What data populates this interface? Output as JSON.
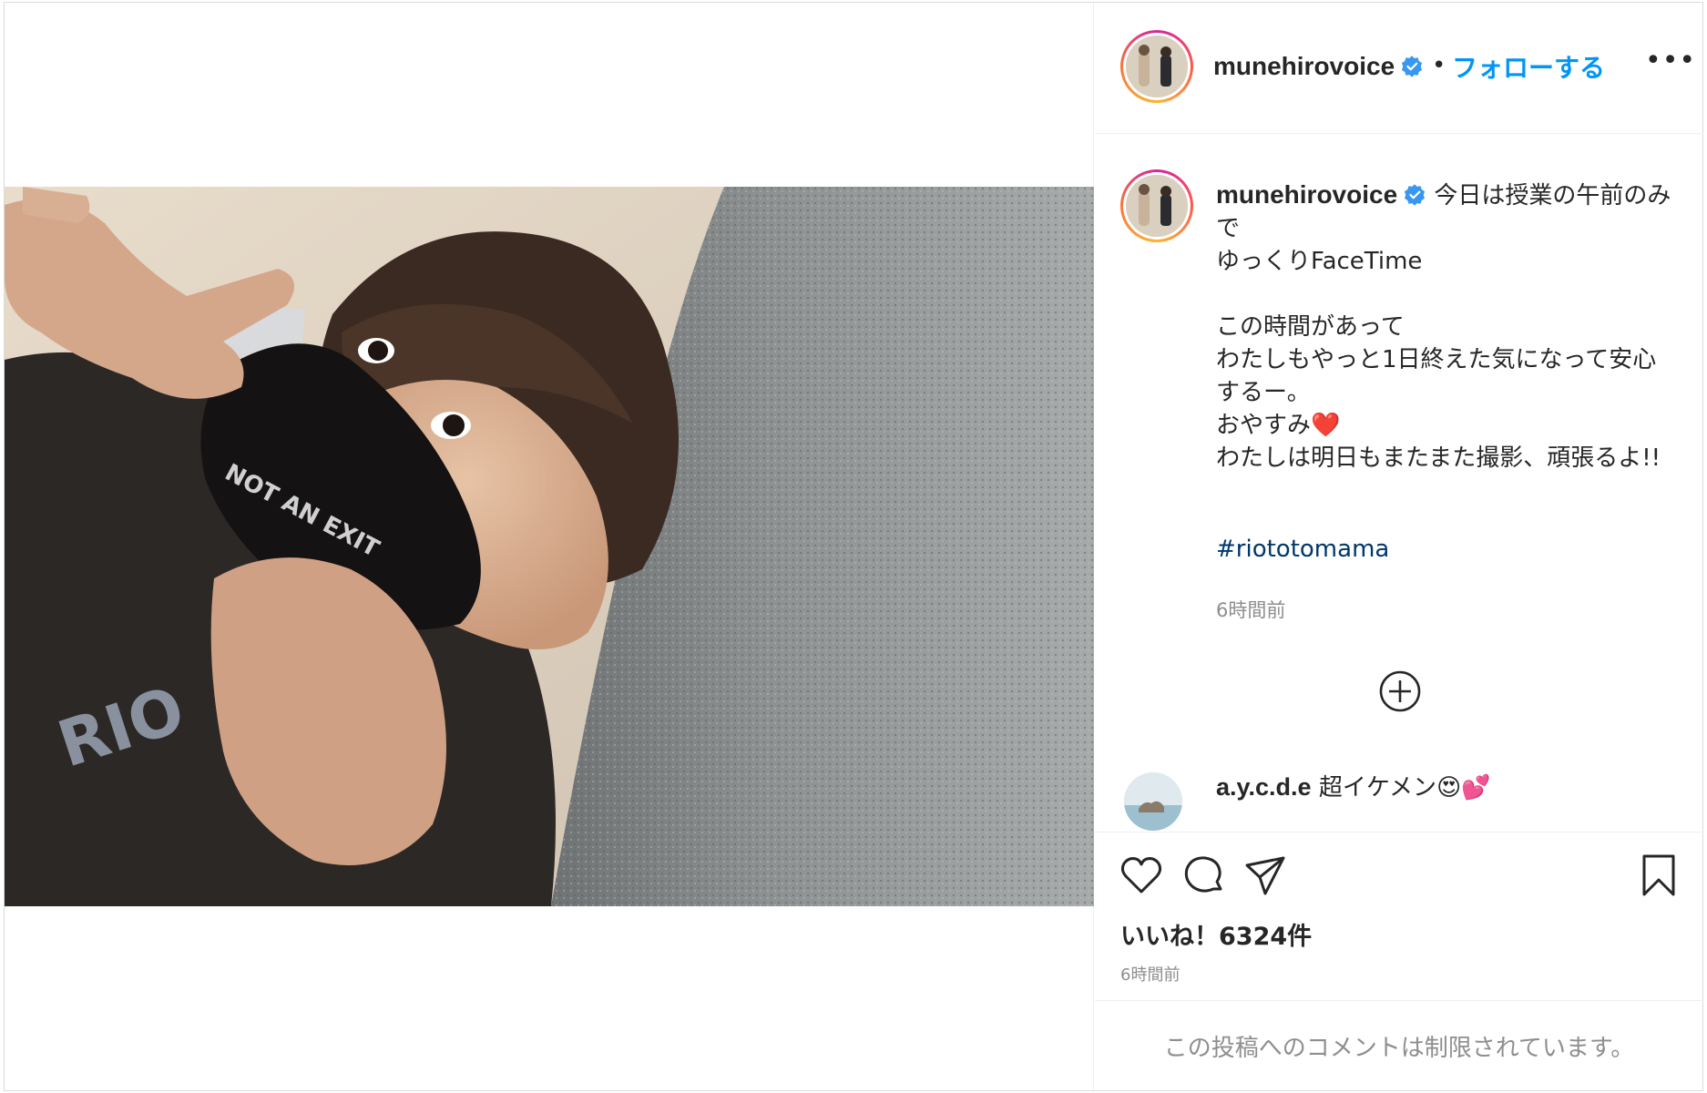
{
  "header": {
    "username": "munehirovoice",
    "separator": "•",
    "follow_label": "フォローする",
    "more_label": "•••"
  },
  "caption": {
    "username": "munehirovoice",
    "text": " 今日は授業の午前のみで\nゆっくりFaceTime\n\nこの時間があって\nわたしもやっと1日終えた気になって安心するー。\nおやすみ",
    "heart": "❤️",
    "text_after": "\nわたしは明日もまたまた撮影、頑張るよ!!",
    "hashtag": "#riototomama",
    "time": "6時間前"
  },
  "comment": {
    "username": "a.y.c.d.e",
    "text": " 超イケメン",
    "emoji": "😍💕"
  },
  "actions": {
    "likes": "いいね！6324件",
    "time": "6時間前"
  },
  "footer": {
    "restricted_text": "この投稿へのコメントは制限されています。"
  },
  "photo": {
    "mask_text": "NOT AN EXIT",
    "shirt_text": "RIO"
  },
  "colors": {
    "link_blue": "#0095f6",
    "hashtag_navy": "#00376b",
    "muted_gray": "#8e8e8e",
    "verified_blue": "#3897f0"
  },
  "icons": {
    "like": "heart-icon",
    "comment": "comment-icon",
    "share": "send-icon",
    "save": "bookmark-icon",
    "load_more": "plus-circle-icon",
    "verified": "verified-badge-icon"
  }
}
